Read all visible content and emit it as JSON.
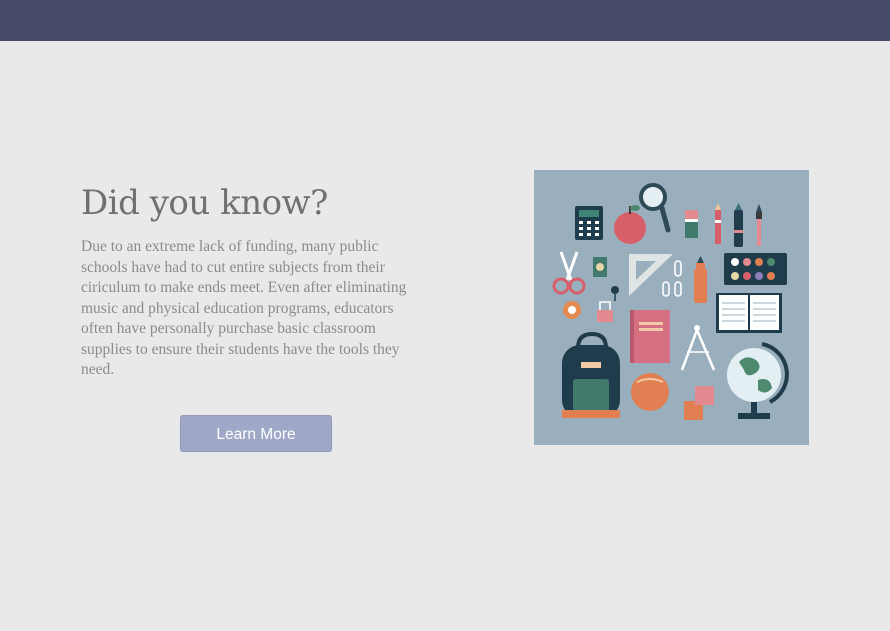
{
  "header": {
    "background_color": "#474b68"
  },
  "promo": {
    "title": "Did you know?",
    "body": "Due to an extreme lack of funding, many public schools have had to cut entire subjects from their ciriculum to make ends meet. Even after eliminating music and physical education programs, educators often have personally purchase basic classroom supplies to ensure their students have the tools they need.",
    "button_label": "Learn More"
  },
  "illustration": {
    "background_color": "#9aafbd",
    "icons": [
      "calculator-icon",
      "apple-icon",
      "magnifier-icon",
      "eraser-icon",
      "pencil-icon",
      "marker-icon",
      "brush-icon",
      "scissors-icon",
      "sharpener-icon",
      "ruler-triangle-icon",
      "paperclip-icon",
      "highlighter-icon",
      "paint-palette-icon",
      "tape-icon",
      "binder-clip-icon",
      "thumbtack-icon",
      "book-icon",
      "open-book-icon",
      "compass-icon",
      "backpack-icon",
      "ball-icon",
      "sticky-notes-icon",
      "globe-icon"
    ]
  }
}
